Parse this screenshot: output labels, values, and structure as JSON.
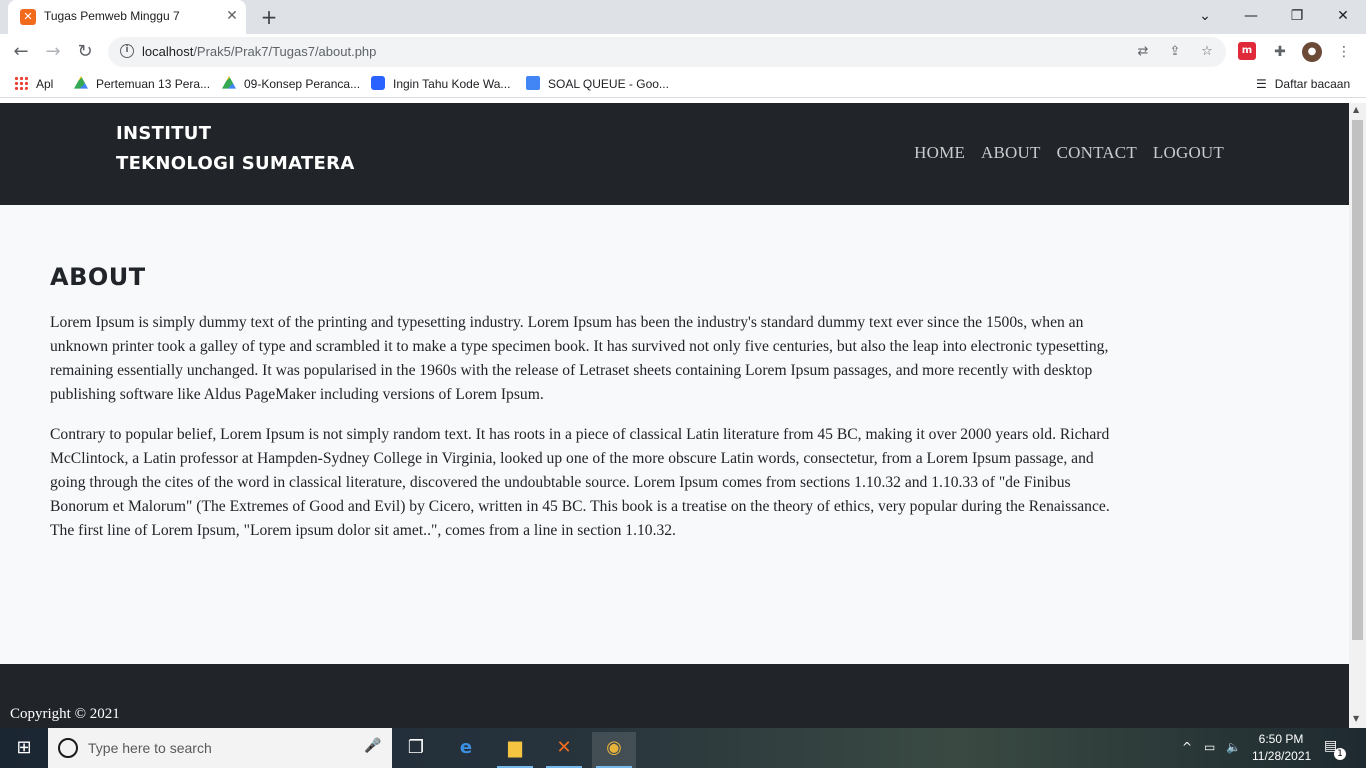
{
  "browser": {
    "tab_title": "Tugas Pemweb Minggu 7",
    "tab_close": "✕",
    "new_tab": "+",
    "url_host": "localhost",
    "url_path": "/Prak5/Prak7/Tugas7/about.php",
    "bookmarks": [
      {
        "label": "Apl",
        "icon": "apps-icon"
      },
      {
        "label": "Pertemuan 13 Pera...",
        "icon": "drive-icon"
      },
      {
        "label": "09-Konsep Peranca...",
        "icon": "drive-icon"
      },
      {
        "label": "Ingin Tahu Kode Wa...",
        "icon": "wave-icon"
      },
      {
        "label": "SOAL QUEUE - Goo...",
        "icon": "docs-icon"
      }
    ],
    "reading_list": "Daftar bacaan"
  },
  "site": {
    "brand_line1": "INSTITUT",
    "brand_line2": "TEKNOLOGI SUMATERA",
    "nav": [
      "HOME",
      "ABOUT",
      "CONTACT",
      "LOGOUT"
    ],
    "page_title": "ABOUT",
    "paragraphs": [
      "Lorem Ipsum is simply dummy text of the printing and typesetting industry. Lorem Ipsum has been the industry's standard dummy text ever since the 1500s, when an unknown printer took a galley of type and scrambled it to make a type specimen book. It has survived not only five centuries, but also the leap into electronic typesetting, remaining essentially unchanged. It was popularised in the 1960s with the release of Letraset sheets containing Lorem Ipsum passages, and more recently with desktop publishing software like Aldus PageMaker including versions of Lorem Ipsum.",
      "Contrary to popular belief, Lorem Ipsum is not simply random text. It has roots in a piece of classical Latin literature from 45 BC, making it over 2000 years old. Richard McClintock, a Latin professor at Hampden-Sydney College in Virginia, looked up one of the more obscure Latin words, consectetur, from a Lorem Ipsum passage, and going through the cites of the word in classical literature, discovered the undoubtable source. Lorem Ipsum comes from sections 1.10.32 and 1.10.33 of \"de Finibus Bonorum et Malorum\" (The Extremes of Good and Evil) by Cicero, written in 45 BC. This book is a treatise on the theory of ethics, very popular during the Renaissance. The first line of Lorem Ipsum, \"Lorem ipsum dolor sit amet..\", comes from a line in section 1.10.32."
    ],
    "copyright": "Copyright © 2021"
  },
  "taskbar": {
    "search_placeholder": "Type here to search",
    "time": "6:50 PM",
    "date": "11/28/2021",
    "notification_count": "1"
  },
  "colors": {
    "header_bg": "#212529",
    "page_bg": "#f8f9fa",
    "tabstrip_bg": "#dee1e6"
  }
}
